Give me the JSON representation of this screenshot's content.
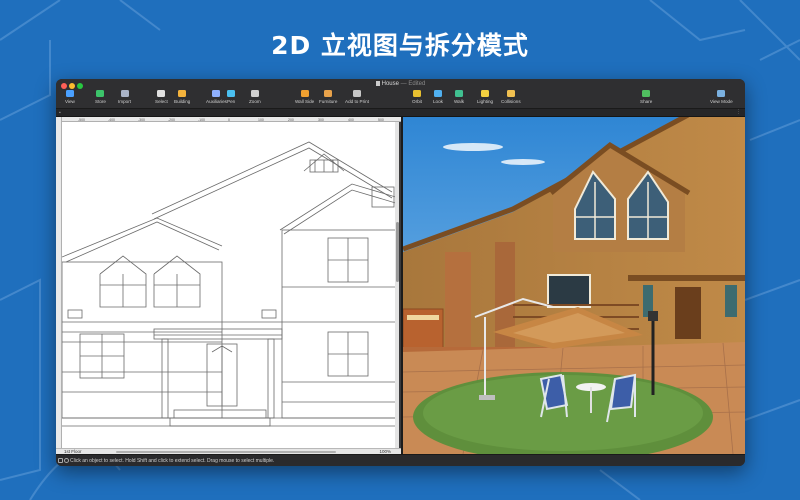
{
  "headline": "2D 立视图与拆分模式",
  "colors": {
    "background": "#1f6fbd",
    "window": "#2b2b2d",
    "grass": "#5f8f3c",
    "sky": "#3d8fd6"
  },
  "window": {
    "title": "House",
    "title_suffix": "— Edited"
  },
  "toolbar": {
    "items": [
      {
        "label": "View",
        "icon": "view-icon",
        "color": "#4aa0ff"
      },
      {
        "label": "Store",
        "icon": "store-cart-icon",
        "color": "#3cc46a"
      },
      {
        "label": "Import",
        "icon": "import-icon",
        "color": "#aab4c8"
      },
      {
        "label": "Select",
        "icon": "select-cursor-icon",
        "color": "#e0e0e0"
      },
      {
        "label": "Building",
        "icon": "building-icon",
        "color": "#f4b33c"
      },
      {
        "label": "Auxiliaries",
        "icon": "auxiliaries-icon",
        "color": "#8fb0ff"
      },
      {
        "label": "Pen",
        "icon": "pen-icon",
        "color": "#4ac0f0"
      },
      {
        "label": "Zoom",
        "icon": "zoom-icon",
        "color": "#d0d0d0"
      },
      {
        "label": "Wall Side",
        "icon": "wall-side-icon",
        "color": "#f0a030"
      },
      {
        "label": "Furniture",
        "icon": "furniture-icon",
        "color": "#e8a24a"
      },
      {
        "label": "Add to Print",
        "icon": "print-icon",
        "color": "#c8c8c8"
      },
      {
        "label": "Orbit",
        "icon": "orbit-icon",
        "color": "#e8c030"
      },
      {
        "label": "Look",
        "icon": "look-eye-icon",
        "color": "#50b0f0"
      },
      {
        "label": "Walk",
        "icon": "walk-icon",
        "color": "#40c090"
      },
      {
        "label": "Lighting",
        "icon": "lighting-bulb-icon",
        "color": "#f4d040"
      },
      {
        "label": "Collisions",
        "icon": "collisions-icon",
        "color": "#f0c050"
      },
      {
        "label": "Share",
        "icon": "share-icon",
        "color": "#50c060"
      },
      {
        "label": "View Mode",
        "icon": "view-mode-icon",
        "color": "#7ab0e0"
      }
    ]
  },
  "ruler": {
    "ticks": [
      "-500",
      "-400",
      "-300",
      "-200",
      "-100",
      "0",
      "100",
      "200",
      "300",
      "400",
      "500"
    ]
  },
  "floorbar": {
    "floor": "1st Floor",
    "zoom": "100%"
  },
  "statusbar": {
    "text": "Click an object to select. Hold Shift and click to extend select. Drag mouse to select multiple."
  }
}
